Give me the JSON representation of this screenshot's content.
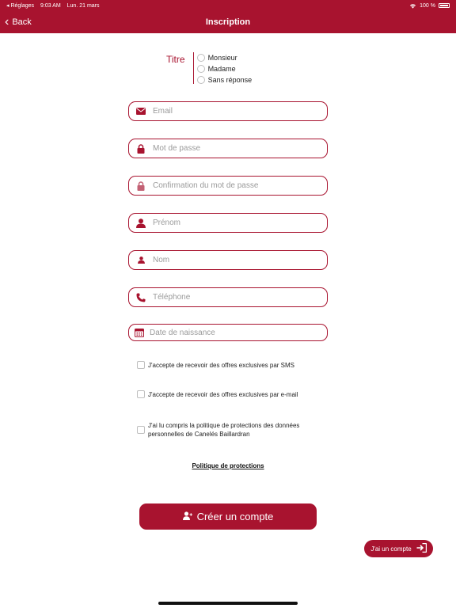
{
  "status_bar": {
    "carrier": "◂ Réglages",
    "time": "9:03 AM",
    "date": "Lun. 21 mars",
    "battery": "100 %"
  },
  "nav": {
    "back_label": "Back",
    "title": "Inscription"
  },
  "titre": {
    "label": "Titre",
    "options": [
      "Monsieur",
      "Madame",
      "Sans réponse"
    ]
  },
  "fields": {
    "email": {
      "placeholder": "Email",
      "value": ""
    },
    "password": {
      "placeholder": "Mot de passe",
      "value": ""
    },
    "password_confirm": {
      "placeholder": "Confirmation du mot de passe",
      "value": ""
    },
    "firstname": {
      "placeholder": "Prénom",
      "value": ""
    },
    "lastname": {
      "placeholder": "Nom",
      "value": ""
    },
    "phone": {
      "placeholder": "Téléphone",
      "value": ""
    },
    "birthdate": {
      "placeholder": "Date de naissance",
      "value": ""
    }
  },
  "checkboxes": {
    "sms": "J'accepte de recevoir des offres exclusives par SMS",
    "email": "J'accepte de recevoir des offres exclusives par e-mail",
    "privacy_line1": "J'ai lu compris la politique de protections des données",
    "privacy_line2": "personnelles de  Canelés Baillardran"
  },
  "links": {
    "policy": "Politique de protections"
  },
  "buttons": {
    "create_account": "Créer un compte",
    "have_account": "J'ai un compte"
  },
  "colors": {
    "brand": "#a8132f",
    "placeholder": "#9a9a9a"
  },
  "icons": {
    "email": "envelope-icon",
    "password": "lock-icon",
    "password_confirm": "lock-icon",
    "firstname": "user-icon",
    "lastname": "user-icon",
    "phone": "phone-icon",
    "birthdate": "calendar-icon",
    "create": "add-user-icon",
    "login": "sign-in-icon"
  }
}
